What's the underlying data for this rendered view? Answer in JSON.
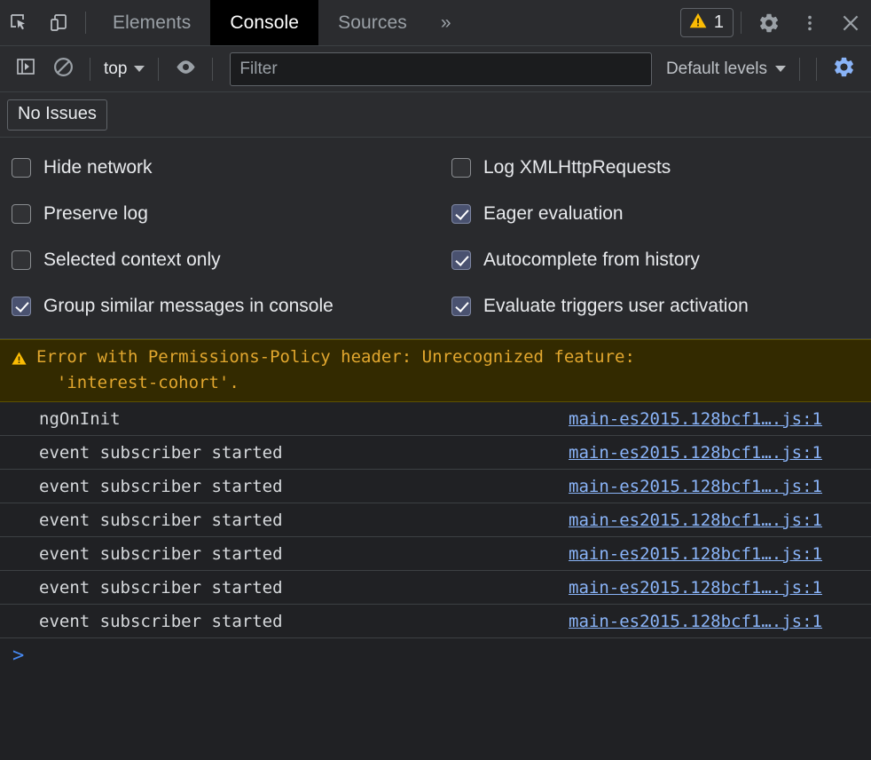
{
  "window": {
    "tabs": [
      {
        "label": "Elements",
        "active": false
      },
      {
        "label": "Console",
        "active": true
      },
      {
        "label": "Sources",
        "active": false
      }
    ],
    "more_tabs_label": "»",
    "warning_badge_count": "1",
    "icons": {
      "inspect": "inspect-element-icon",
      "device": "device-toolbar-icon",
      "warning": "warning-triangle-icon",
      "settings": "gear-icon",
      "more": "more-vertical-icon",
      "close": "close-icon"
    }
  },
  "toolbar": {
    "sidebar_toggle": "console-sidebar-toggle-icon",
    "clear_console": "clear-console-icon",
    "context_value": "top",
    "live_expression": "eye-icon",
    "filter_placeholder": "Filter",
    "filter_value": "",
    "levels_label": "Default levels",
    "settings_gear": "console-settings-gear-icon"
  },
  "issues": {
    "no_issues_label": "No Issues"
  },
  "settings": {
    "left_column": [
      {
        "label": "Hide network",
        "checked": false
      },
      {
        "label": "Preserve log",
        "checked": false
      },
      {
        "label": "Selected context only",
        "checked": false
      },
      {
        "label": "Group similar messages in console",
        "checked": true
      }
    ],
    "right_column": [
      {
        "label": "Log XMLHttpRequests",
        "checked": false
      },
      {
        "label": "Eager evaluation",
        "checked": true
      },
      {
        "label": "Autocomplete from history",
        "checked": true
      },
      {
        "label": "Evaluate triggers user activation",
        "checked": true
      }
    ]
  },
  "console": {
    "warning_message": "Error with Permissions-Policy header: Unrecognized feature:\n  'interest-cohort'.",
    "messages": [
      {
        "text": "ngOnInit",
        "source": "main-es2015.128bcf1….js:1"
      },
      {
        "text": "event subscriber started",
        "source": "main-es2015.128bcf1….js:1"
      },
      {
        "text": "event subscriber started",
        "source": "main-es2015.128bcf1….js:1"
      },
      {
        "text": "event subscriber started",
        "source": "main-es2015.128bcf1….js:1"
      },
      {
        "text": "event subscriber started",
        "source": "main-es2015.128bcf1….js:1"
      },
      {
        "text": "event subscriber started",
        "source": "main-es2015.128bcf1….js:1"
      },
      {
        "text": "event subscriber started",
        "source": "main-es2015.128bcf1….js:1"
      }
    ],
    "prompt_caret": ">"
  },
  "colors": {
    "chrome_bg": "#2b2c2f",
    "panel_bg": "#292a2d",
    "console_bg": "#202124",
    "active_tab_bg": "#000000",
    "link_blue": "#8ab4f8",
    "warning_yellow": "#e2a72e",
    "warning_bg": "#332a00",
    "accent_blue": "#8ab4f8",
    "checkbox_checked": "#4a5270"
  }
}
